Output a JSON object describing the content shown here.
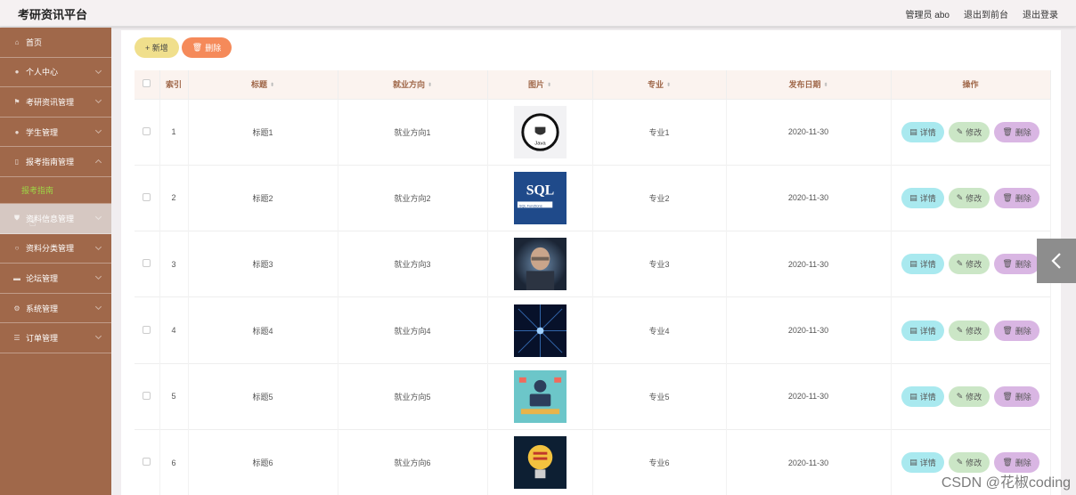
{
  "header": {
    "title": "考研资讯平台",
    "user": "管理员 abo",
    "front": "退出到前台",
    "logout": "退出登录"
  },
  "sidebar": {
    "items": [
      {
        "label": "首页",
        "icon": "home-icon"
      },
      {
        "label": "个人中心",
        "icon": "user-icon"
      },
      {
        "label": "考研资讯管理",
        "icon": "flag-icon"
      },
      {
        "label": "学生管理",
        "icon": "user-icon"
      },
      {
        "label": "报考指南管理",
        "icon": "pin-icon"
      },
      {
        "label": "报考指南",
        "icon": ""
      },
      {
        "label": "资料信息管理",
        "icon": "shield-icon"
      },
      {
        "label": "资料分类管理",
        "icon": "circle-icon"
      },
      {
        "label": "论坛管理",
        "icon": "chat-icon"
      },
      {
        "label": "系统管理",
        "icon": "gear-icon"
      },
      {
        "label": "订单管理",
        "icon": "list-icon"
      }
    ]
  },
  "toolbar": {
    "add": "+ 新增",
    "delete": "删除"
  },
  "table": {
    "headers": [
      "索引",
      "标题",
      "就业方向",
      "图片",
      "专业",
      "发布日期",
      "操作"
    ],
    "rows": [
      {
        "index": "1",
        "title": "标题1",
        "direction": "就业方向1",
        "image": "java-logo",
        "major": "专业1",
        "date": "2020-11-30"
      },
      {
        "index": "2",
        "title": "标题2",
        "direction": "就业方向2",
        "image": "sql-book",
        "major": "专业2",
        "date": "2020-11-30"
      },
      {
        "index": "3",
        "title": "标题3",
        "direction": "就业方向3",
        "image": "hacker-photo",
        "major": "专业3",
        "date": "2020-11-30"
      },
      {
        "index": "4",
        "title": "标题4",
        "direction": "就业方向4",
        "image": "binary-tunnel",
        "major": "专业4",
        "date": "2020-11-30"
      },
      {
        "index": "5",
        "title": "标题5",
        "direction": "就业方向5",
        "image": "developer-illustration",
        "major": "专业5",
        "date": "2020-11-30"
      },
      {
        "index": "6",
        "title": "标题6",
        "direction": "就业方向6",
        "image": "lightbulb-illustration",
        "major": "专业6",
        "date": "2020-11-30"
      }
    ],
    "ops": {
      "detail": "详情",
      "edit": "修改",
      "delete": "删除"
    }
  },
  "thumb_text": {
    "java": "Java",
    "sql": "SQL",
    "sql_sub": "SQL Functions"
  },
  "watermark": "CSDN @花椒coding",
  "colors": {
    "sidebar": "#a0684a",
    "accent_green": "#9dd645",
    "add_button": "#f0df8c",
    "delete_button": "#f58a5a",
    "detail_button": "#a9e9ef",
    "edit_button": "#cbe6c6",
    "row_delete_button": "#d9b6e3"
  }
}
